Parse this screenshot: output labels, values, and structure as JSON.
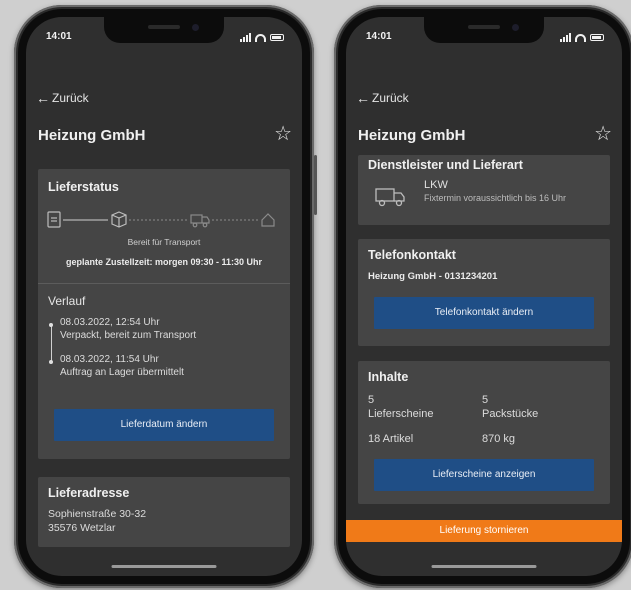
{
  "phone_left": {
    "time": "14:01",
    "back_label": "Zurück",
    "title": "Heizung GmbH",
    "lieferstatus": {
      "heading": "Lieferstatus",
      "step_label": "Bereit für Transport",
      "planned_time": "geplante Zustellzeit: morgen 09:30 - 11:30 Uhr"
    },
    "verlauf": {
      "heading": "Verlauf",
      "entries": [
        {
          "date": "08.03.2022, 12:54 Uhr",
          "text": "Verpackt, bereit zum Transport"
        },
        {
          "date": "08.03.2022, 11:54 Uhr",
          "text": "Auftrag an Lager übermittelt"
        }
      ],
      "button_label": "Lieferdatum ändern"
    },
    "lieferadresse": {
      "heading": "Lieferadresse",
      "street": "Sophienstraße 30-32",
      "city": "35576 Wetzlar"
    }
  },
  "phone_right": {
    "time": "14:01",
    "back_label": "Zurück",
    "title": "Heizung GmbH",
    "dienstleister": {
      "heading": "Dienstleister und Lieferart",
      "vehicle": "LKW",
      "note": "Fixtermin voraussichtlich bis 16 Uhr"
    },
    "telefon": {
      "heading": "Telefonkontakt",
      "value": "Heizung GmbH - 0131234201",
      "button_label": "Telefonkontakt ändern"
    },
    "inhalte": {
      "heading": "Inhalte",
      "lieferscheine_count": "5",
      "lieferscheine_label": "Lieferscheine",
      "packstuecke_count": "5",
      "packstuecke_label": "Packstücke",
      "artikel": "18 Artikel",
      "gewicht": "870 kg",
      "button_label": "Lieferscheine anzeigen"
    },
    "storno_label": "Lieferung stornieren"
  },
  "colors": {
    "screen_bg": "#2f2f2f",
    "card_bg": "#454545",
    "button_blue": "#1f4e86",
    "accent_orange": "#f07a18"
  },
  "icons": [
    "back-arrow-icon",
    "star-icon",
    "document-icon",
    "package-icon",
    "truck-icon",
    "home-icon",
    "signal-icon",
    "wifi-icon",
    "battery-icon"
  ]
}
